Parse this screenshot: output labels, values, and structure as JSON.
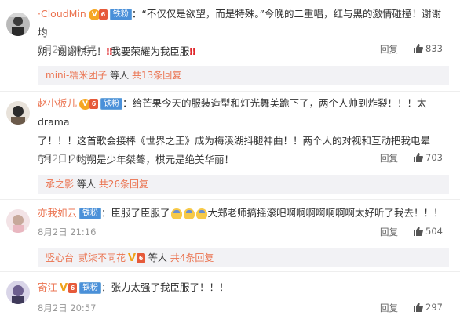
{
  "comments": [
    {
      "user": "·CloudMin",
      "fan_badge": "铁粉",
      "text_a": "：“不仅仅是欲望，而是特殊。”今晚的二重唱，红与黑的激情碰撞！谢谢均",
      "text_b": "朔，谢谢棋元！",
      "excl": "‼",
      "text_c": "我要荣耀为我臣服",
      "time": "8月2日 20:57",
      "reply_label": "回复",
      "likes": "833",
      "sub_user": "mini-糯米团子",
      "sub_mid": "等人",
      "sub_total": "共13条回复"
    },
    {
      "user": "赵小板儿",
      "fan_badge": "铁粉",
      "line1": "：给芒果今天的服装造型和灯光舞美跪下了，两个人帅到炸裂！！！太drama",
      "line2": "了！！！这首歌会接棒《世界之王》成为梅溪湖抖腿神曲！！两个人的对视和互动把我电晕",
      "line3": "了！！！均朔是少年桀骜，棋元是绝美华丽！",
      "time": "8月2日 20:57",
      "reply_label": "回复",
      "likes": "703",
      "sub_user": "承之影",
      "sub_mid": "等人",
      "sub_total": "共26条回复"
    },
    {
      "user": "亦我如云",
      "fan_badge": "铁粉",
      "text_a": "：臣服了臣服了",
      "text_b": "大郑老师搞摇滚吧啊啊啊啊啊啊啊太好听了我去！！！",
      "time": "8月2日 21:16",
      "reply_label": "回复",
      "likes": "504",
      "sub_user": "竖心台_贰柒不同花",
      "sub_mid": "等人",
      "sub_total": "共4条回复"
    },
    {
      "user": "寄江",
      "fan_badge": "铁粉",
      "text_a": "：张力太强了我臣服了！！！",
      "time": "8月2日 20:57",
      "reply_label": "回复",
      "likes": "297"
    }
  ],
  "colors": {
    "username": "#eb7350",
    "fan_badge": "#4a90d9",
    "vip_badge": "#f5a623",
    "sub_bg": "#f2f2f5"
  },
  "icons": {
    "like": "thumbs-up-icon",
    "vip": "v-badge-icon",
    "level": "level-badge-icon"
  }
}
